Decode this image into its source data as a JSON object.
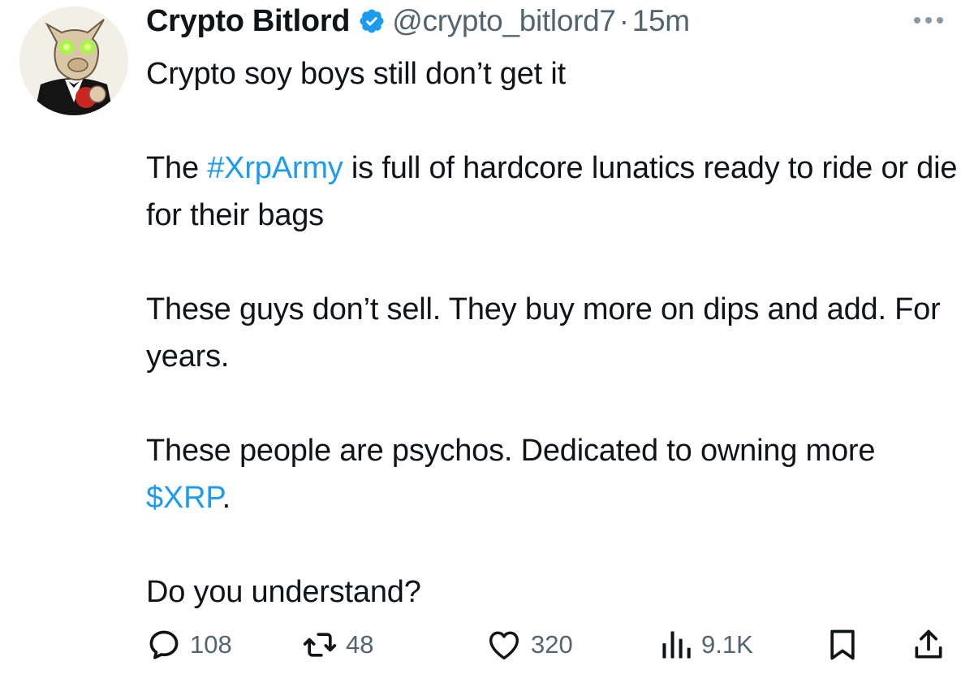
{
  "author": {
    "display_name": "Crypto Bitlord",
    "handle": "@crypto_bitlord7",
    "separator": "·",
    "time": "15m",
    "verified_icon": "verified-badge-icon",
    "verified_color": "#1d9bf0"
  },
  "tweet": {
    "line1": "Crypto soy boys still don’t get it",
    "p2_before": "The ",
    "p2_hashtag": "#XrpArmy",
    "p2_after": " is full of hardcore lunatics ready to ride or die for their bags",
    "p3": "These guys don’t sell. They buy more on dips and add. For years.",
    "p4_before": "These people are psychos. Dedicated to owning more ",
    "p4_cashtag": "$XRP",
    "p4_after": ".",
    "p5": "Do you understand?"
  },
  "actions": {
    "reply_icon": "reply-icon",
    "reply_count": "108",
    "retweet_icon": "retweet-icon",
    "retweet_count": "48",
    "like_icon": "heart-icon",
    "like_count": "320",
    "views_icon": "analytics-icon",
    "views_count": "9.1K",
    "bookmark_icon": "bookmark-icon",
    "share_icon": "share-icon"
  },
  "colors": {
    "text": "#0f1419",
    "secondary": "#536471",
    "link": "#1d9bf0"
  }
}
